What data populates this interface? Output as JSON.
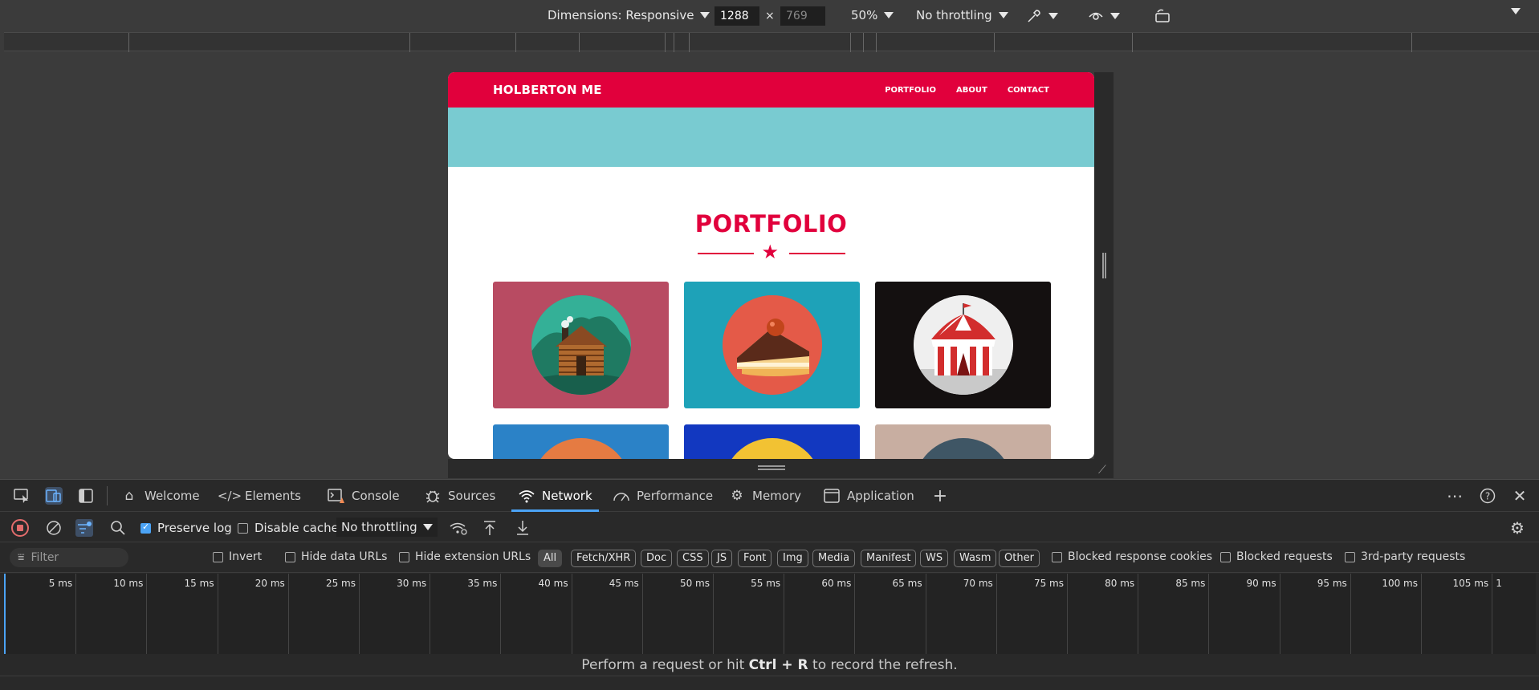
{
  "device_toolbar": {
    "dimensions_label": "Dimensions: Responsive",
    "width_value": "1288",
    "height_value": "769",
    "times": "×",
    "zoom": "50%",
    "throttling": "No throttling"
  },
  "site": {
    "brand": "HOLBERTON ME",
    "nav": [
      "PORTFOLIO",
      "ABOUT",
      "CONTACT"
    ],
    "section_title": "PORTFOLIO",
    "tile_colors": [
      "#b84b62",
      "#1ea2b8",
      "#141010",
      "#2b82c7",
      "#1238c0",
      "#c8aea1"
    ]
  },
  "devtools_tabs": {
    "welcome": "Welcome",
    "elements": "Elements",
    "console": "Console",
    "sources": "Sources",
    "network": "Network",
    "performance": "Performance",
    "memory": "Memory",
    "application": "Application"
  },
  "network_toolbar": {
    "preserve_log": "Preserve log",
    "disable_cache": "Disable cache",
    "throttling": "No throttling"
  },
  "filter_bar": {
    "filter_placeholder": "Filter",
    "invert": "Invert",
    "hide_data_urls": "Hide data URLs",
    "hide_extension_urls": "Hide extension URLs",
    "types": [
      "All",
      "Fetch/XHR",
      "Doc",
      "CSS",
      "JS",
      "Font",
      "Img",
      "Media",
      "Manifest",
      "WS",
      "Wasm",
      "Other"
    ],
    "blocked_response_cookies": "Blocked response cookies",
    "blocked_requests": "Blocked requests",
    "third_party_requests": "3rd-party requests"
  },
  "timeline": {
    "ticks": [
      "5 ms",
      "10 ms",
      "15 ms",
      "20 ms",
      "25 ms",
      "30 ms",
      "35 ms",
      "40 ms",
      "45 ms",
      "50 ms",
      "55 ms",
      "60 ms",
      "65 ms",
      "70 ms",
      "75 ms",
      "80 ms",
      "85 ms",
      "90 ms",
      "95 ms",
      "100 ms",
      "105 ms",
      "1"
    ]
  },
  "hint": {
    "before": "Perform a request or hit ",
    "shortcut": "Ctrl + R",
    "after": " to record the refresh."
  }
}
